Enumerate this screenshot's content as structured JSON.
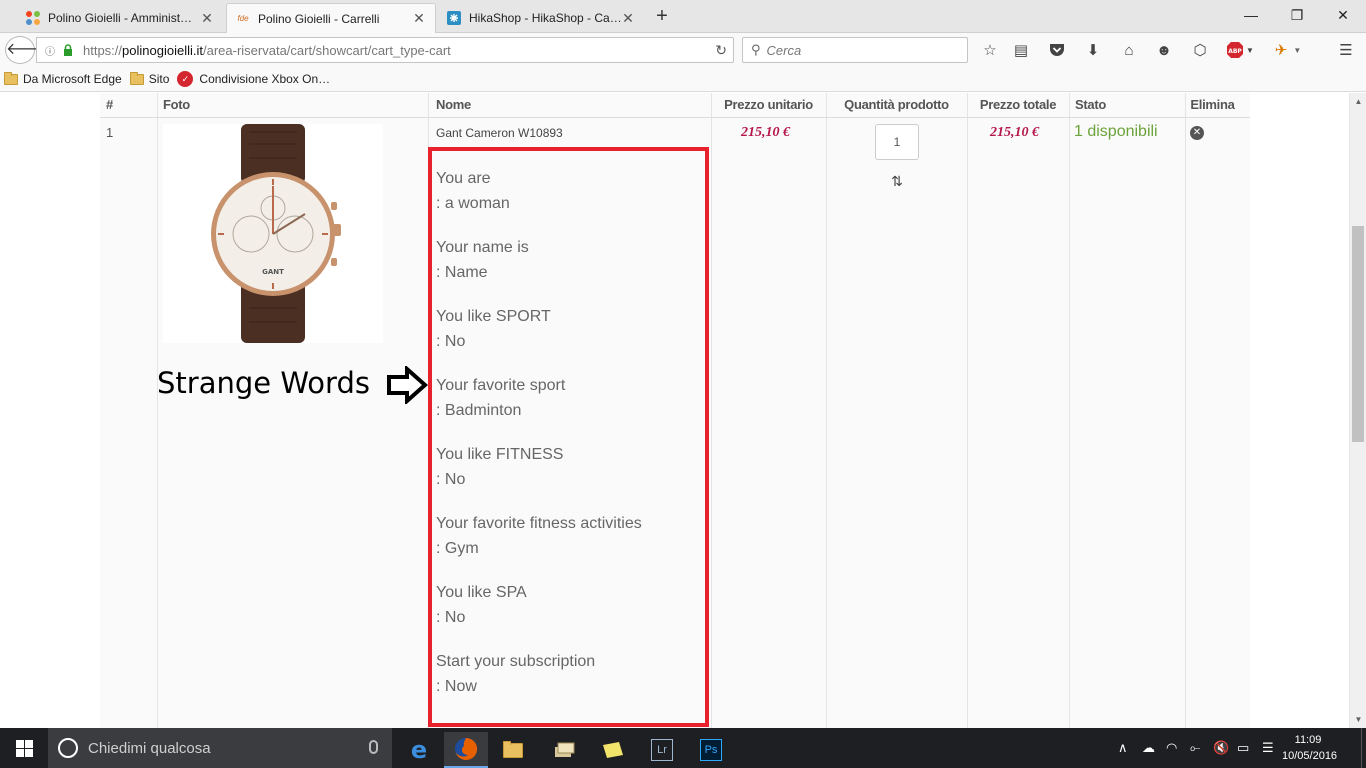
{
  "browser": {
    "tabs": [
      {
        "title": "Polino Gioielli - Amminist…",
        "active": false
      },
      {
        "title": "Polino Gioielli - Carrelli",
        "active": true
      },
      {
        "title": "HikaShop - HikaShop - Ca…",
        "active": false
      }
    ],
    "url": {
      "protocol": "https://",
      "host": "polinogioielli.it",
      "path": "/area-riservata/cart/showcart/cart_type-cart"
    },
    "search_placeholder": "Cerca",
    "bookmarks": [
      "Da Microsoft Edge",
      "Sito",
      "Condivisione Xbox On…"
    ]
  },
  "cart": {
    "columns": {
      "num": "#",
      "photo": "Foto",
      "name": "Nome",
      "unit_price": "Prezzo unitario",
      "quantity": "Quantità prodotto",
      "total_price": "Prezzo totale",
      "status": "Stato",
      "delete": "Elimina"
    },
    "item": {
      "num": "1",
      "name": "Gant Cameron W10893",
      "unit_price": "215,10 €",
      "quantity": "1",
      "total_price": "215,10 €",
      "status": "1 disponibili"
    },
    "custom_fields": [
      {
        "label": "You are",
        "value": ": a woman"
      },
      {
        "label": "Your name is",
        "value": ": Name"
      },
      {
        "label": "You like SPORT",
        "value": ": No"
      },
      {
        "label": "Your favorite sport",
        "value": ": Badminton"
      },
      {
        "label": "You like FITNESS",
        "value": ": No"
      },
      {
        "label": "Your favorite fitness activities",
        "value": ": Gym"
      },
      {
        "label": "You like SPA",
        "value": ": No"
      },
      {
        "label": "Start your subscription",
        "value": ": Now"
      }
    ],
    "annotation": "Strange Words",
    "highlight_color": "#e8222c"
  },
  "taskbar": {
    "search_placeholder": "Chiedimi qualcosa",
    "time": "11:09",
    "date": "10/05/2016"
  },
  "colors": {
    "price": "#b5174a",
    "stock": "#6ba33a"
  }
}
